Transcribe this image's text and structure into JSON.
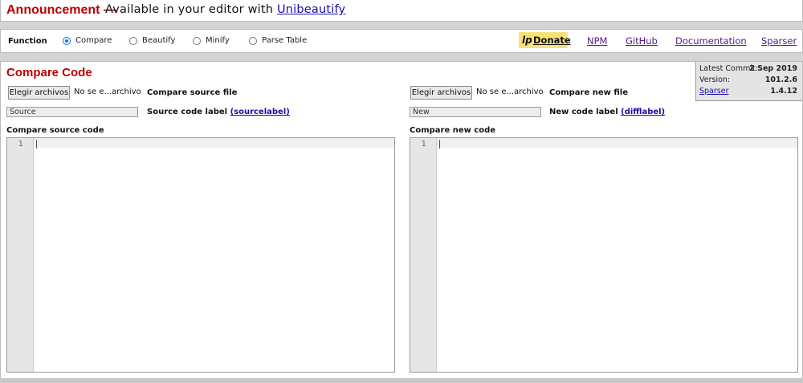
{
  "announcement": {
    "prefix": "Announcement —",
    "text": "Available in your editor with",
    "link": "Unibeautify"
  },
  "function_bar": {
    "label": "Function",
    "modes": [
      {
        "label": "Compare",
        "selected": true
      },
      {
        "label": "Beautify",
        "selected": false
      },
      {
        "label": "Minify",
        "selected": false
      },
      {
        "label": "Parse Table",
        "selected": false
      }
    ],
    "donate_icon": "lp",
    "donate": "Donate",
    "links": [
      "NPM",
      "GitHub",
      "Documentation",
      "Sparser"
    ]
  },
  "main": {
    "title": "Compare Code",
    "commit": {
      "latest_label": "Latest Commit:",
      "latest_value": "2 Sep 2019",
      "version_label": "Version:",
      "version_value": "101.2.6",
      "sparser_label": "Sparser",
      "sparser_value": "1.4.12"
    },
    "source": {
      "file_button": "Elegir archivos",
      "file_name": "No se e...archivo",
      "file_label": "Compare source file",
      "label_value": "Source",
      "label_text": "Source code label",
      "label_link": "(sourcelabel)",
      "code_heading": "Compare source code",
      "line_number": "1"
    },
    "new": {
      "file_button": "Elegir archivos",
      "file_name": "No se e...archivo",
      "file_label": "Compare new file",
      "label_value": "New",
      "label_text": "New code label",
      "label_link": "(difflabel)",
      "code_heading": "Compare new code",
      "line_number": "1"
    }
  }
}
